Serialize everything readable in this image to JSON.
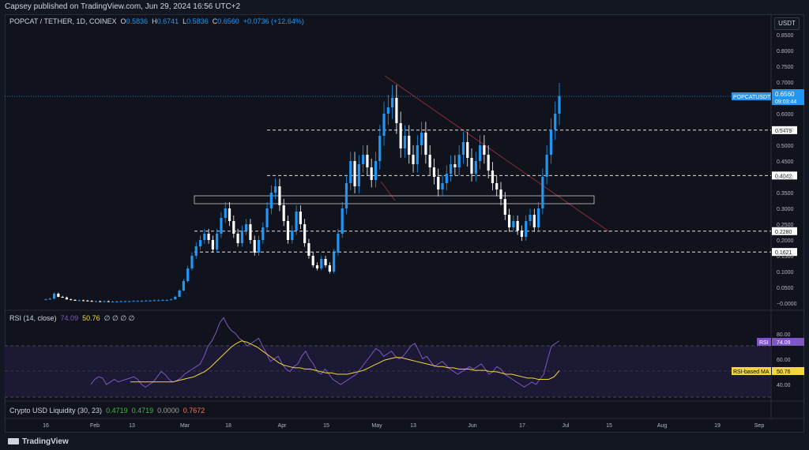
{
  "header": {
    "publisher": "Capsey published on TradingView.com, Jun 29, 2024 16:56 UTC+2"
  },
  "symbol": {
    "title": "POPCAT / TETHER, 1D, COINEX",
    "o_label": "O",
    "o": "0.5836",
    "h_label": "H",
    "h": "0.6741",
    "l_label": "L",
    "l": "0.5836",
    "c_label": "C",
    "c": "0.6560",
    "change": "+0.0736 (+12.64%)"
  },
  "currency": "USDT",
  "price_tag": {
    "symbol": "POPCATUSDT",
    "price": "0.6560",
    "countdown": "09:03:44"
  },
  "levels": [
    {
      "label": "0.5479",
      "value": 0.5479
    },
    {
      "label": "0.4042",
      "value": 0.4042
    },
    {
      "label": "0.2280",
      "value": 0.228
    },
    {
      "label": "0.1621",
      "value": 0.1621
    }
  ],
  "rsi_panel": {
    "title": "RSI (14, close)",
    "rsi_value": "74.09",
    "ma_value": "50.76",
    "extra": "∅ ∅ ∅ ∅",
    "rsi_tag": "RSI",
    "ma_tag": "RSI-based MA",
    "axis": [
      "80.00",
      "60.00",
      "40.00"
    ]
  },
  "liquidity_panel": {
    "title": "Crypto USD Liquidity (30, 23)",
    "v1": "0.4719",
    "v2": "0.4719",
    "v3": "0.0000",
    "v4": "0.7672"
  },
  "x_axis": [
    "16",
    "Feb",
    "13",
    "Mar",
    "18",
    "Apr",
    "15",
    "May",
    "13",
    "Jun",
    "17",
    "Jul",
    "15",
    "Aug",
    "19",
    "Sep"
  ],
  "brand": "TradingView",
  "colors": {
    "up": "#2196f3",
    "down": "#ffffff",
    "rsi": "#7e57c2",
    "ma": "#f5d638",
    "bg": "#131722"
  },
  "chart_data": {
    "type": "candlestick",
    "y_axis_ticks": [
      "0.8500",
      "0.8000",
      "0.7500",
      "0.7000",
      "0.6500",
      "0.6000",
      "0.5500",
      "0.5000",
      "0.4500",
      "0.4000",
      "0.3500",
      "0.3000",
      "0.2500",
      "0.2000",
      "0.1500",
      "0.1000",
      "0.0500",
      "−0.0000"
    ],
    "ylim": [
      0,
      0.9
    ],
    "closes": [
      0.012,
      0.014,
      0.03,
      0.02,
      0.018,
      0.012,
      0.01,
      0.008,
      0.009,
      0.008,
      0.007,
      0.006,
      0.006,
      0.005,
      0.006,
      0.005,
      0.005,
      0.005,
      0.006,
      0.006,
      0.006,
      0.007,
      0.007,
      0.007,
      0.008,
      0.008,
      0.009,
      0.009,
      0.01,
      0.01,
      0.012,
      0.02,
      0.04,
      0.07,
      0.11,
      0.15,
      0.18,
      0.2,
      0.22,
      0.2,
      0.17,
      0.22,
      0.27,
      0.3,
      0.26,
      0.22,
      0.19,
      0.23,
      0.25,
      0.2,
      0.16,
      0.2,
      0.24,
      0.3,
      0.35,
      0.37,
      0.31,
      0.26,
      0.2,
      0.23,
      0.29,
      0.25,
      0.19,
      0.15,
      0.12,
      0.11,
      0.14,
      0.12,
      0.1,
      0.16,
      0.22,
      0.3,
      0.38,
      0.45,
      0.37,
      0.44,
      0.47,
      0.43,
      0.39,
      0.45,
      0.53,
      0.6,
      0.62,
      0.65,
      0.57,
      0.49,
      0.53,
      0.47,
      0.44,
      0.5,
      0.54,
      0.47,
      0.43,
      0.4,
      0.36,
      0.38,
      0.41,
      0.44,
      0.43,
      0.47,
      0.51,
      0.46,
      0.41,
      0.45,
      0.5,
      0.47,
      0.42,
      0.38,
      0.36,
      0.33,
      0.28,
      0.24,
      0.26,
      0.23,
      0.21,
      0.26,
      0.28,
      0.24,
      0.3,
      0.4,
      0.47,
      0.55,
      0.6,
      0.656
    ],
    "rsi": [
      40,
      44,
      46,
      45,
      40,
      42,
      44,
      42,
      43,
      44,
      45,
      46,
      44,
      40,
      38,
      40,
      42,
      46,
      50,
      48,
      44,
      42,
      43,
      45,
      48,
      50,
      52,
      54,
      56,
      62,
      70,
      74,
      80,
      88,
      92,
      86,
      82,
      80,
      76,
      74,
      70,
      72,
      74,
      76,
      70,
      64,
      58,
      60,
      62,
      56,
      52,
      50,
      54,
      56,
      62,
      66,
      60,
      56,
      50,
      48,
      52,
      48,
      44,
      42,
      40,
      42,
      44,
      46,
      48,
      52,
      56,
      60,
      64,
      68,
      66,
      62,
      64,
      66,
      62,
      60,
      62,
      66,
      70,
      72,
      66,
      60,
      62,
      58,
      54,
      56,
      58,
      55,
      52,
      50,
      48,
      50,
      52,
      54,
      52,
      54,
      56,
      52,
      48,
      50,
      54,
      52,
      48,
      46,
      44,
      42,
      40,
      38,
      40,
      42,
      40,
      44,
      48,
      60,
      70,
      72,
      74.09
    ],
    "rsi_ma": [
      42,
      42,
      42,
      42,
      42,
      42,
      42,
      42,
      42,
      43,
      44,
      45,
      46,
      48,
      50,
      53,
      57,
      61,
      65,
      69,
      72,
      74,
      73,
      71,
      69,
      66,
      63,
      60,
      57,
      55,
      54,
      53,
      53,
      52,
      52,
      51,
      50,
      49,
      49,
      48,
      48,
      48,
      49,
      50,
      51,
      53,
      55,
      57,
      59,
      60,
      61,
      61,
      60,
      59,
      58,
      57,
      56,
      55,
      54,
      54,
      53,
      53,
      52,
      52,
      52,
      51,
      51,
      51,
      50,
      50,
      49,
      48,
      48,
      47,
      46,
      45,
      45,
      44,
      44,
      44,
      46,
      50.76
    ],
    "rsi_levels": {
      "upper": 70,
      "mid": 50,
      "lower": 30
    }
  }
}
